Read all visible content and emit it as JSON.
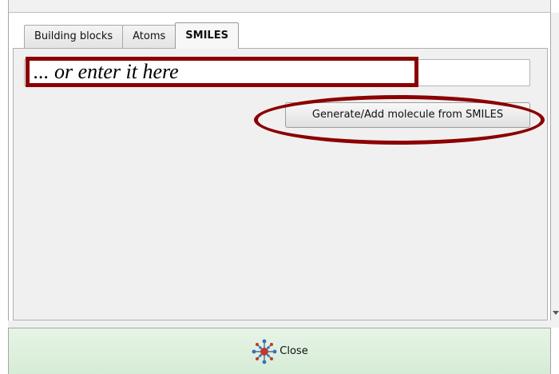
{
  "tabs": [
    {
      "label": "Building blocks",
      "active": false
    },
    {
      "label": "Atoms",
      "active": false
    },
    {
      "label": "SMILES",
      "active": true
    }
  ],
  "smiles": {
    "annotation_text": "... or enter it here",
    "input_value": ""
  },
  "generate_button": {
    "label": "Generate/Add molecule from SMILES"
  },
  "close_button": {
    "label": "Close",
    "icon": "molecule-icon"
  },
  "colors": {
    "annotation": "#8b0000",
    "close_bg": "#dff0df"
  }
}
